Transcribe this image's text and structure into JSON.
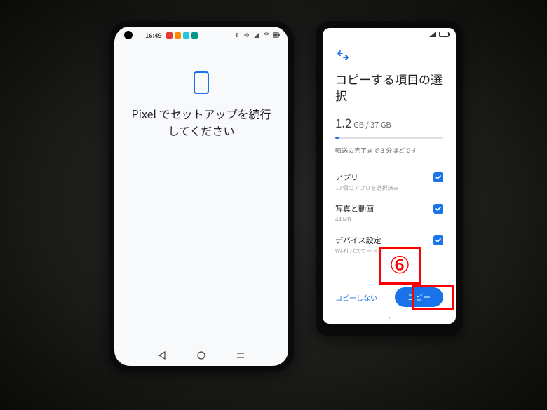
{
  "left_phone": {
    "statusbar": {
      "time": "16:49",
      "app_badges": [
        "red",
        "orange",
        "cyan",
        "teal"
      ]
    },
    "title_line1": "Pixel でセットアップを続行",
    "title_line2": "してください"
  },
  "right_phone": {
    "transfer_glyph": "⤡",
    "title": "コピーする項目の選択",
    "size_used": "1.2",
    "size_used_unit": "GB",
    "size_total": "37 GB",
    "progress_percent": 4,
    "eta": "転送の完了まで 3 分ほどです",
    "items": [
      {
        "title": "アプリ",
        "sub": "10 個のアプリを選択済み",
        "checked": true
      },
      {
        "title": "写真と動画",
        "sub": "44 MB",
        "checked": true
      },
      {
        "title": "デバイス設定",
        "sub": "Wi-Fi パスワード…",
        "checked": true
      }
    ],
    "skip_label": "コピーしない",
    "copy_label": "コピー"
  },
  "annotations": {
    "step_number": "⑥"
  }
}
